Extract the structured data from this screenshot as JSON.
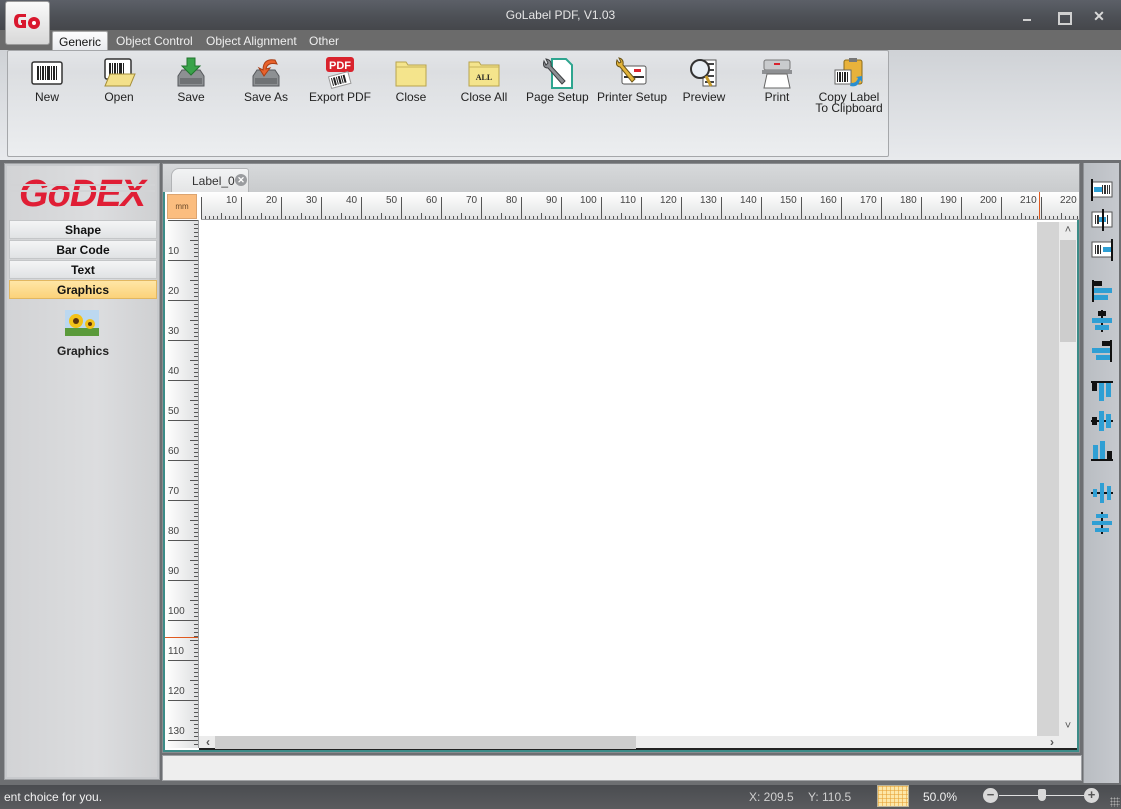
{
  "window": {
    "title": "GoLabel PDF, V1.03",
    "controls": {
      "minimize": "minimize",
      "maximize": "maximize",
      "close": "close"
    }
  },
  "app_button": {
    "icon": "godex-go-logo",
    "text": "Go"
  },
  "ribbon_tabs": [
    {
      "label": "Generic",
      "active": true
    },
    {
      "label": "Object Control",
      "active": false
    },
    {
      "label": "Object Alignment",
      "active": false
    },
    {
      "label": "Other",
      "active": false
    }
  ],
  "ribbon": {
    "buttons": [
      {
        "label": "New",
        "icon": "new-label-icon"
      },
      {
        "label": "Open",
        "icon": "open-folder-icon"
      },
      {
        "label": "Save",
        "icon": "save-disk-icon"
      },
      {
        "label": "Save As",
        "icon": "save-as-icon"
      },
      {
        "label": "Export PDF",
        "icon": "export-pdf-icon"
      },
      {
        "label": "Close",
        "icon": "close-folder-icon"
      },
      {
        "label": "Close All",
        "icon": "close-all-folder-icon"
      },
      {
        "label": "Page Setup",
        "icon": "page-setup-wrench-icon"
      },
      {
        "label": "Printer Setup",
        "icon": "printer-setup-icon"
      },
      {
        "label": "Preview",
        "icon": "preview-magnifier-icon"
      },
      {
        "label": "Print",
        "icon": "printer-icon"
      },
      {
        "label": "Copy Label",
        "label2": "To Clipboard",
        "icon": "copy-clipboard-icon"
      }
    ]
  },
  "left_panel": {
    "logo_text": "GoDEX",
    "categories": [
      {
        "label": "Shape",
        "active": false
      },
      {
        "label": "Bar Code",
        "active": false
      },
      {
        "label": "Text",
        "active": false
      },
      {
        "label": "Graphics",
        "active": true
      }
    ],
    "items": [
      {
        "label": "Graphics",
        "icon": "sunflower-image-icon"
      }
    ]
  },
  "document": {
    "tab_label": "Label_0",
    "unit": "mm",
    "h_ruler_labels": [
      "10",
      "20",
      "30",
      "40",
      "50",
      "60",
      "70",
      "80",
      "90",
      "100",
      "110",
      "120",
      "130",
      "140",
      "150",
      "160",
      "170",
      "180",
      "190",
      "200",
      "210",
      "220"
    ],
    "v_ruler_labels": [
      "10",
      "20",
      "30",
      "40",
      "50",
      "60",
      "70",
      "80",
      "90",
      "100",
      "110",
      "120",
      "130"
    ],
    "cursor_x_mm": 209.5,
    "cursor_y_mm": 110.5,
    "vertical_scroll_position": 0.0,
    "horizontal_scroll_fraction": 0.49
  },
  "align_toolbar": [
    {
      "icon": "align-object-left-icon"
    },
    {
      "icon": "align-object-center-icon"
    },
    {
      "icon": "align-object-right-icon"
    },
    {
      "icon": "align-left-edges-icon"
    },
    {
      "icon": "align-horizontal-centers-icon"
    },
    {
      "icon": "align-right-edges-icon"
    },
    {
      "icon": "align-top-edges-icon"
    },
    {
      "icon": "align-vertical-centers-icon"
    },
    {
      "icon": "align-bottom-edges-icon"
    },
    {
      "icon": "distribute-horizontal-icon"
    },
    {
      "icon": "distribute-vertical-icon"
    }
  ],
  "status_bar": {
    "message": "ent choice for you.",
    "x_label": "X: 209.5",
    "y_label": "Y: 110.5",
    "zoom_percent": "50.0%",
    "zoom_slider_fraction": 0.5,
    "colors": {
      "accent_orange": "#fbbd7f",
      "active_tab_yellow": "#fbd27a",
      "canvas_border_teal": "#3c8c88",
      "cursor_marker": "#e05a20"
    }
  }
}
